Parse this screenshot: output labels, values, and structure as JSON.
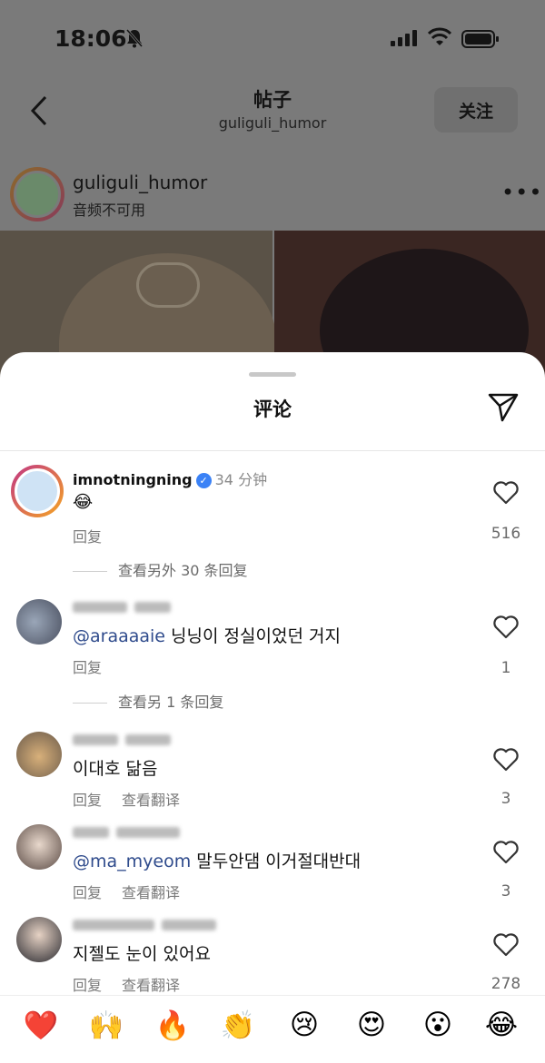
{
  "status": {
    "time": "18:06"
  },
  "nav": {
    "title": "帖子",
    "subtitle": "guliguli_humor",
    "follow_label": "关注"
  },
  "post": {
    "username": "guliguli_humor",
    "meta": "音频不可用",
    "more": "•••"
  },
  "sheet": {
    "title": "评论"
  },
  "comments": [
    {
      "username": "imnotningning",
      "time": "34 分钟",
      "text": "😂",
      "reply_label": "回复",
      "likes": "516",
      "more_replies": "查看另外 30 条回复"
    },
    {
      "mention": "@araaaaie",
      "text": "닝닝이 정실이었던 거지",
      "reply_label": "回复",
      "likes": "1",
      "more_replies": "查看另 1 条回复"
    },
    {
      "text": "이대호 닮음",
      "reply_label": "回复",
      "translate_label": "查看翻译",
      "likes": "3"
    },
    {
      "mention": "@ma_myeom",
      "text": "말두안댐 이거절대반대",
      "reply_label": "回复",
      "translate_label": "查看翻译",
      "likes": "3"
    },
    {
      "text": "지젤도 눈이 있어요",
      "reply_label": "回复",
      "translate_label": "查看翻译",
      "likes": "278"
    }
  ],
  "emoji_bar": [
    "❤️",
    "🙌",
    "🔥",
    "👏",
    "😢",
    "😍",
    "😮",
    "😂"
  ],
  "colors": {
    "mention": "#2f4b8c",
    "verified": "#3b82f6"
  }
}
